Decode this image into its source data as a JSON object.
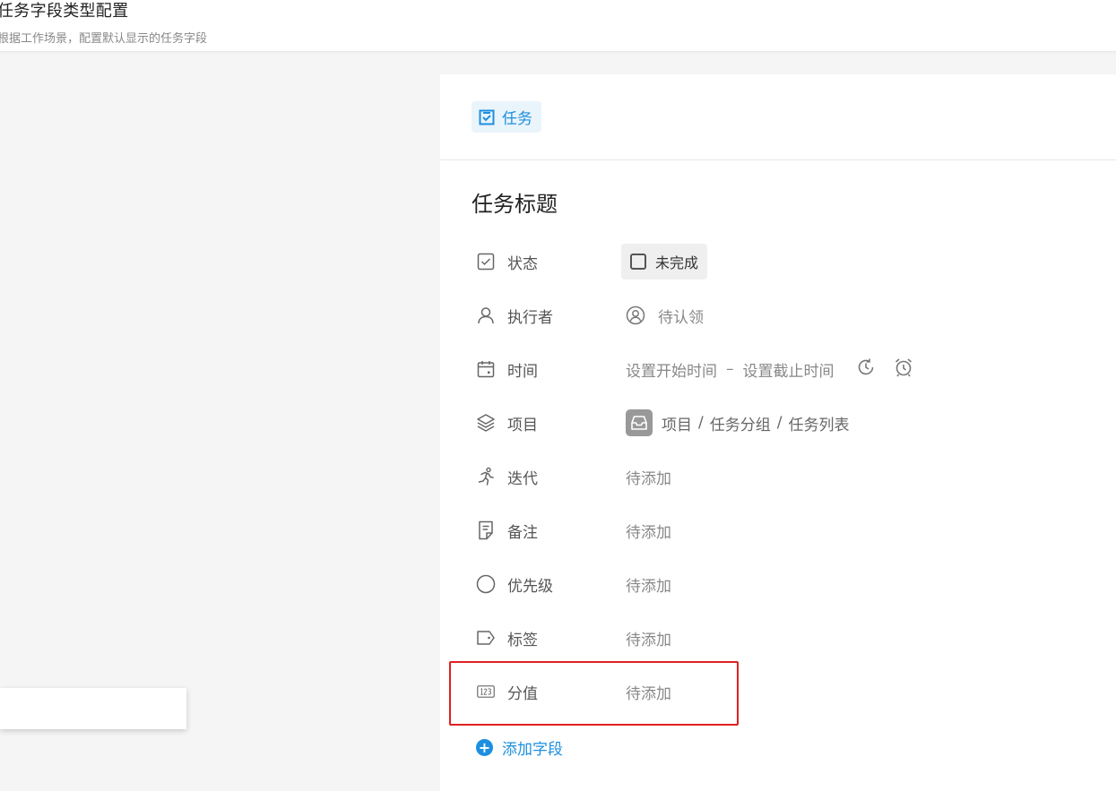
{
  "header": {
    "title": "任务字段类型配置",
    "subtitle": "根据工作场景，配置默认显示的任务字段"
  },
  "panel": {
    "type_chip": "任务",
    "task_title": "任务标题",
    "fields": {
      "status": {
        "label": "状态",
        "value": "未完成"
      },
      "assignee": {
        "label": "执行者",
        "value": "待认领"
      },
      "time": {
        "label": "时间",
        "start": "设置开始时间",
        "separator": "–",
        "end": "设置截止时间"
      },
      "project": {
        "label": "项目",
        "path": [
          "项目",
          "任务分组",
          "任务列表"
        ],
        "separator": "/"
      },
      "iteration": {
        "label": "迭代",
        "value": "待添加"
      },
      "note": {
        "label": "备注",
        "value": "待添加"
      },
      "priority": {
        "label": "优先级",
        "value": "待添加"
      },
      "tag": {
        "label": "标签",
        "value": "待添加"
      },
      "score": {
        "label": "分值",
        "value": "待添加"
      }
    },
    "add_field": "添加字段"
  },
  "colors": {
    "accent": "#1d8fe0",
    "highlight": "#e02020",
    "chip_bg": "#eaf4fb"
  }
}
